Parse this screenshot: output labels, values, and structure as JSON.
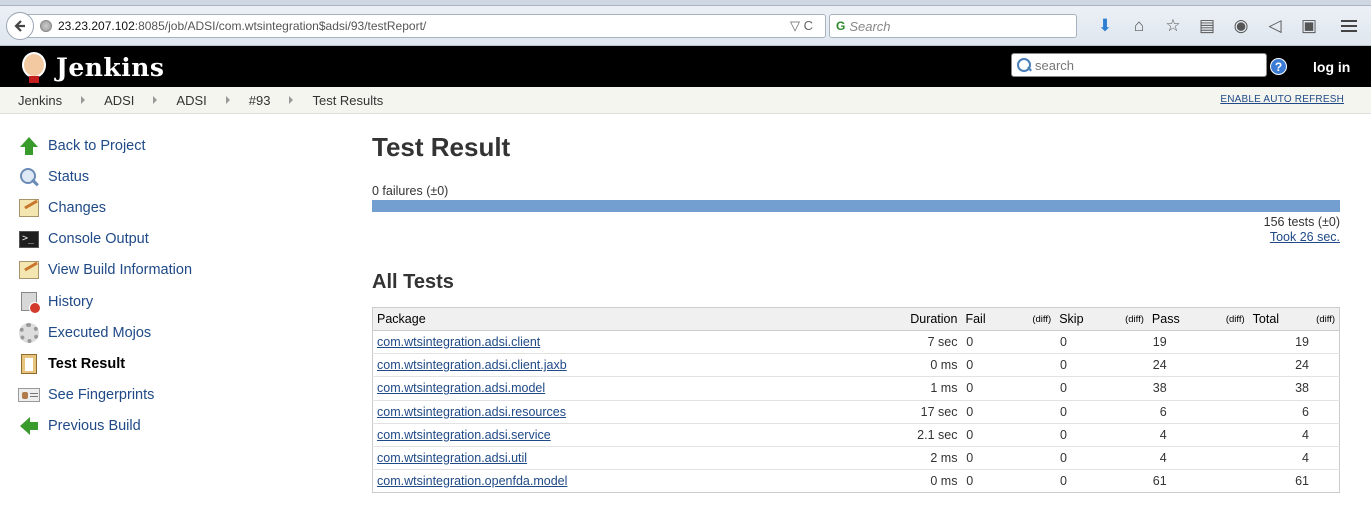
{
  "browser": {
    "url_host": "23.23.207.102",
    "url_rest": ":8085/job/ADSI/com.wtsintegration$adsi/93/testReport/",
    "search_placeholder": "Search",
    "url_actions": "▽ C"
  },
  "header": {
    "title": "Jenkins",
    "search_placeholder": "search",
    "help_label": "?",
    "login_label": "log in"
  },
  "breadcrumbs": [
    "Jenkins",
    "ADSI",
    "ADSI",
    "#93",
    "Test Results"
  ],
  "auto_refresh_label": "ENABLE AUTO REFRESH",
  "sidebar": {
    "items": [
      {
        "label": "Back to Project",
        "icon": "up-arrow-icon"
      },
      {
        "label": "Status",
        "icon": "magnifier-icon"
      },
      {
        "label": "Changes",
        "icon": "notepad-icon"
      },
      {
        "label": "Console Output",
        "icon": "terminal-icon"
      },
      {
        "label": "View Build Information",
        "icon": "notepad-icon"
      },
      {
        "label": "History",
        "icon": "history-icon"
      },
      {
        "label": "Executed Mojos",
        "icon": "gear-icon"
      },
      {
        "label": "Test Result",
        "icon": "clipboard-icon",
        "active": true
      },
      {
        "label": "See Fingerprints",
        "icon": "fingerprint-icon"
      },
      {
        "label": "Previous Build",
        "icon": "left-arrow-icon"
      }
    ]
  },
  "main": {
    "title": "Test Result",
    "failures": "0 failures (±0)",
    "tests_count": "156 tests (±0)",
    "took": "Took 26 sec.",
    "all_tests_heading": "All Tests",
    "pass_bar_fraction": 1.0,
    "pass_color": "#729fcf"
  },
  "table": {
    "headers": {
      "package": "Package",
      "duration": "Duration",
      "fail": "Fail",
      "diff": "(diff)",
      "skip": "Skip",
      "pass": "Pass",
      "total": "Total"
    },
    "rows": [
      {
        "package": "com.wtsintegration.adsi.client",
        "duration": "7 sec",
        "fail": "0",
        "skip": "0",
        "pass": "19",
        "total": "19"
      },
      {
        "package": "com.wtsintegration.adsi.client.jaxb",
        "duration": "0 ms",
        "fail": "0",
        "skip": "0",
        "pass": "24",
        "total": "24"
      },
      {
        "package": "com.wtsintegration.adsi.model",
        "duration": "1 ms",
        "fail": "0",
        "skip": "0",
        "pass": "38",
        "total": "38"
      },
      {
        "package": "com.wtsintegration.adsi.resources",
        "duration": "17 sec",
        "fail": "0",
        "skip": "0",
        "pass": "6",
        "total": "6"
      },
      {
        "package": "com.wtsintegration.adsi.service",
        "duration": "2.1 sec",
        "fail": "0",
        "skip": "0",
        "pass": "4",
        "total": "4"
      },
      {
        "package": "com.wtsintegration.adsi.util",
        "duration": "2 ms",
        "fail": "0",
        "skip": "0",
        "pass": "4",
        "total": "4"
      },
      {
        "package": "com.wtsintegration.openfda.model",
        "duration": "0 ms",
        "fail": "0",
        "skip": "0",
        "pass": "61",
        "total": "61"
      }
    ]
  }
}
